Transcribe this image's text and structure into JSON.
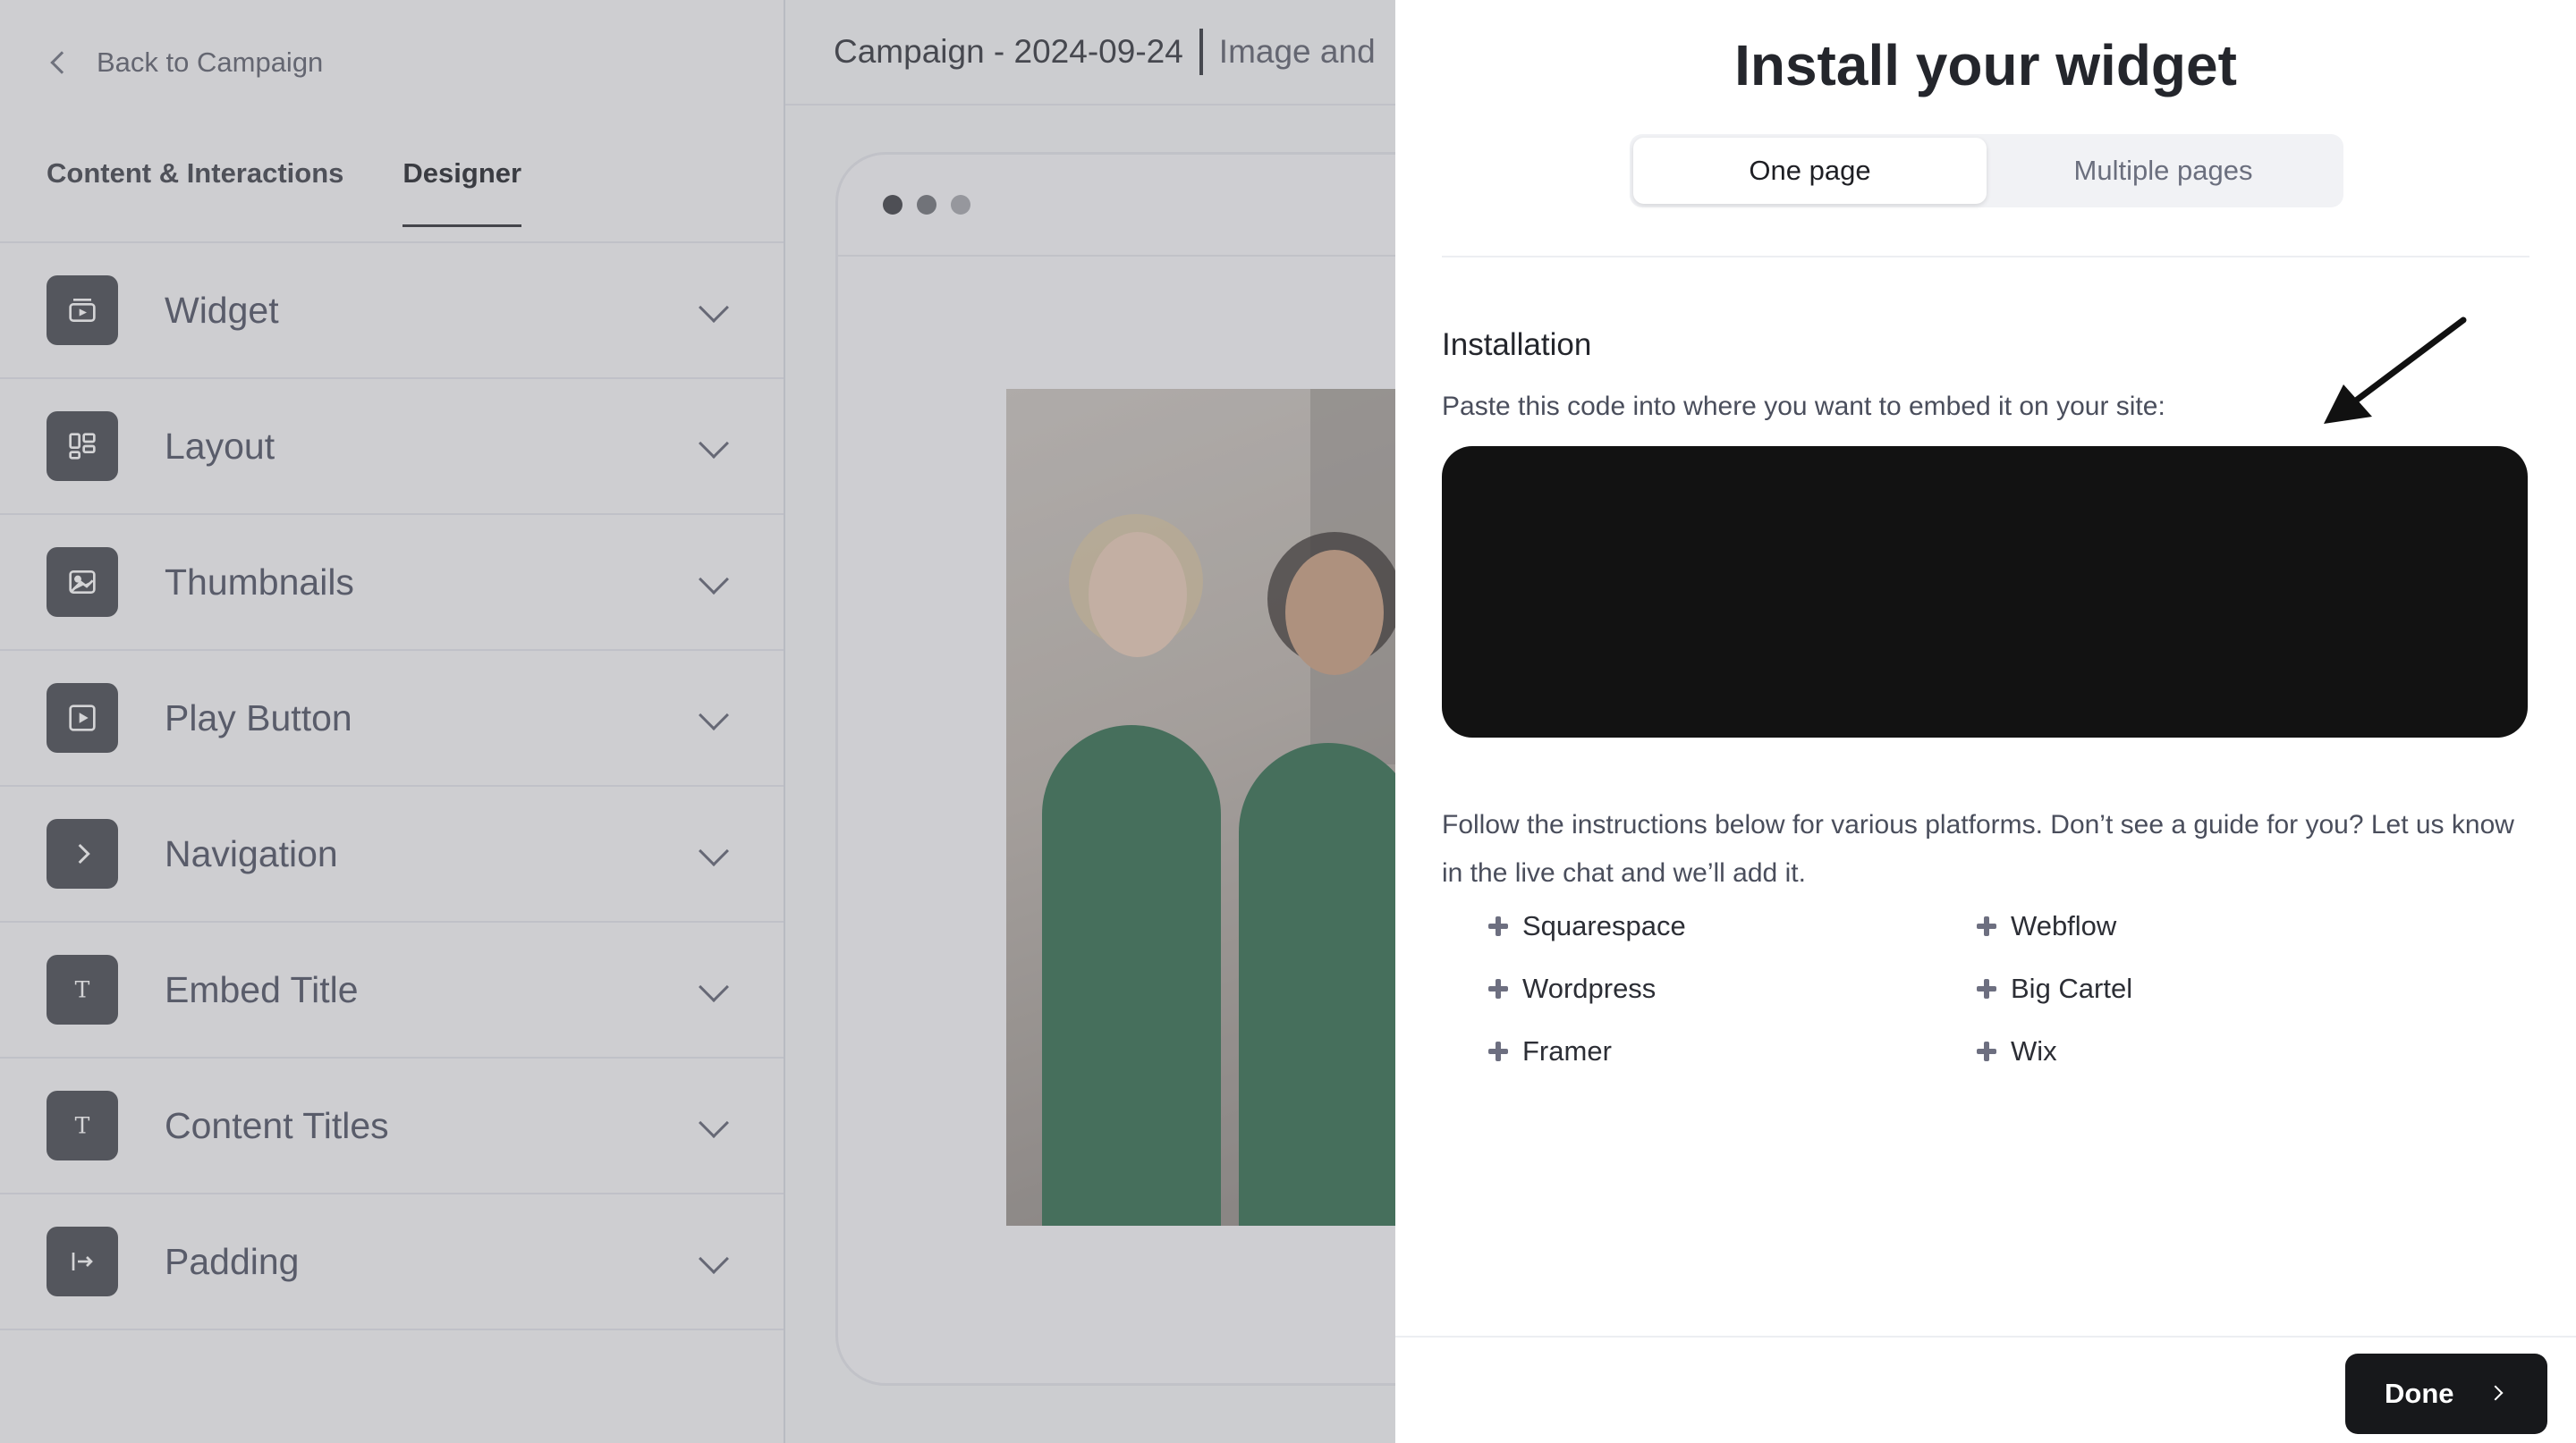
{
  "sidebar": {
    "back_label": "Back to Campaign",
    "tabs": [
      {
        "label": "Content & Interactions",
        "active": false
      },
      {
        "label": "Designer",
        "active": true
      }
    ],
    "sections": [
      {
        "label": "Widget",
        "icon": "widget-icon"
      },
      {
        "label": "Layout",
        "icon": "layout-icon"
      },
      {
        "label": "Thumbnails",
        "icon": "image-icon"
      },
      {
        "label": "Play Button",
        "icon": "play-icon"
      },
      {
        "label": "Navigation",
        "icon": "chevron-right-icon"
      },
      {
        "label": "Embed Title",
        "icon": "text-icon"
      },
      {
        "label": "Content Titles",
        "icon": "text-icon"
      },
      {
        "label": "Padding",
        "icon": "padding-icon"
      }
    ]
  },
  "preview": {
    "campaign_title": "Campaign - 2024-09-24",
    "mode_label": "Image and",
    "window_dots": [
      "#3a3c41",
      "#6e7077",
      "#a4a6ac"
    ]
  },
  "install": {
    "title": "Install your widget",
    "tabs": [
      {
        "label": "One page",
        "active": true
      },
      {
        "label": "Multiple pages",
        "active": false
      }
    ],
    "heading": "Installation",
    "subtitle": "Paste this code into where you want to embed it on your site:",
    "follow_text": "Follow the instructions below for various platforms. Don’t see a guide for you? Let us know in the live chat and we’ll add it.",
    "platforms": [
      "Squarespace",
      "Webflow",
      "Wordpress",
      "Big Cartel",
      "Framer",
      "Wix"
    ],
    "done_label": "Done"
  },
  "colors": {
    "panel_bg": "#ffffff",
    "code_bg": "#121212",
    "done_bg": "#17181b",
    "sidebar_bg": "#f7f7f8"
  }
}
